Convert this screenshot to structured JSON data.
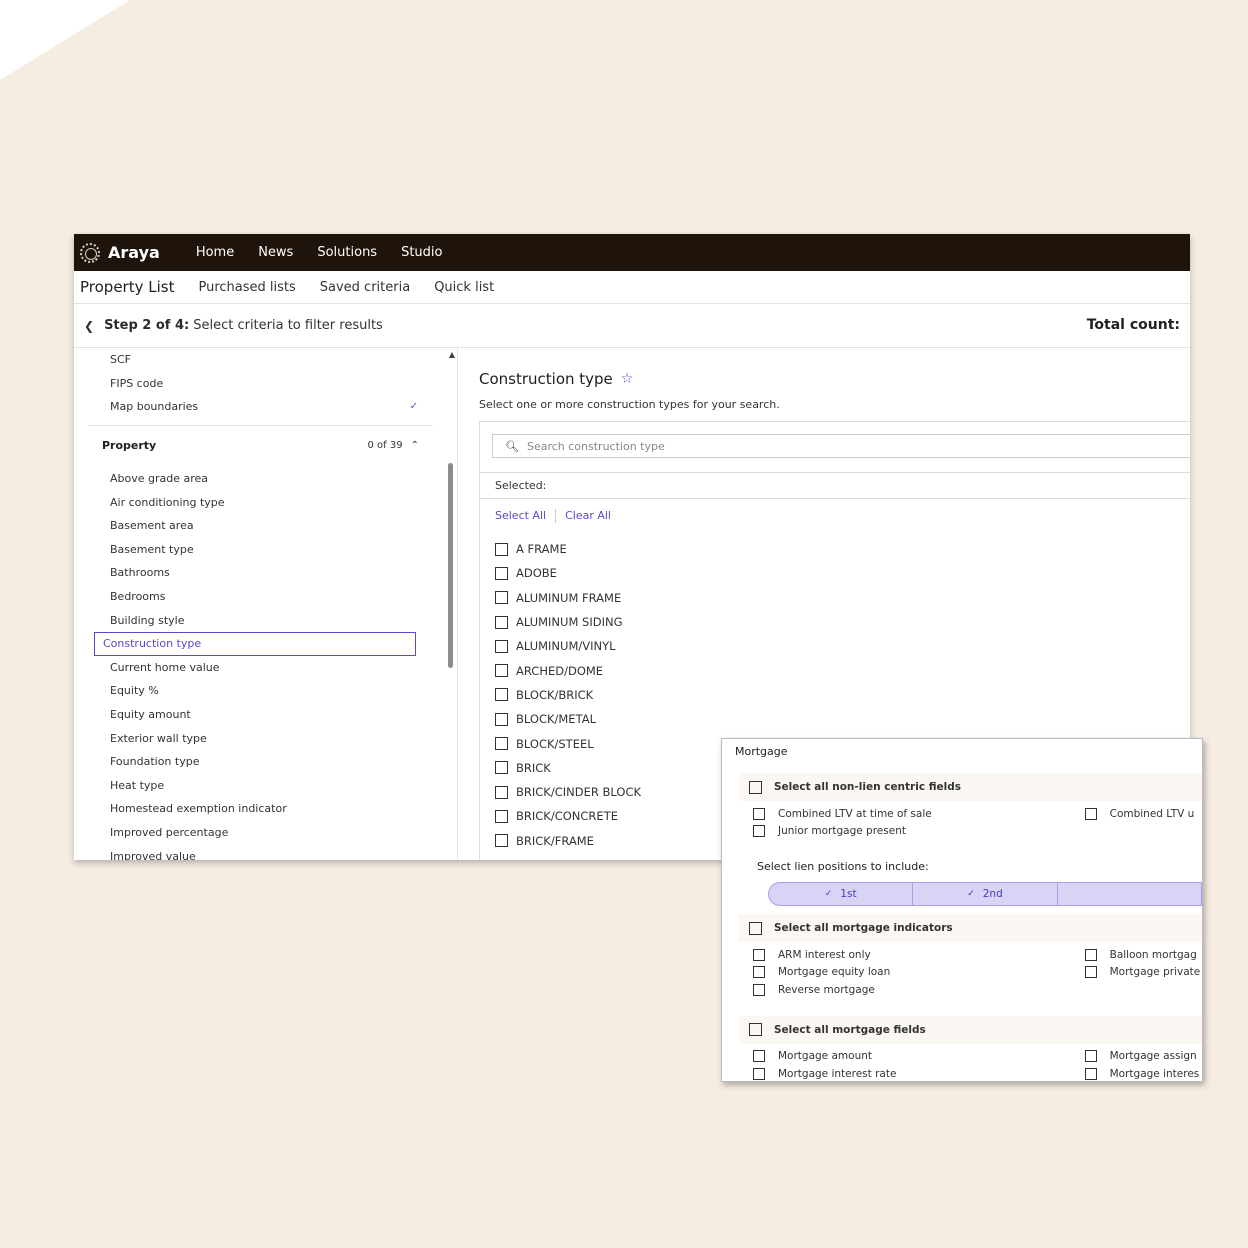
{
  "nav": {
    "brand": "Araya",
    "items": [
      "Home",
      "News",
      "Solutions",
      "Studio"
    ]
  },
  "subnav": {
    "title": "Property List",
    "items": [
      "Purchased lists",
      "Saved criteria",
      "Quick list"
    ]
  },
  "step": {
    "strong": "Step 2 of 4:",
    "text": "Select criteria to filter results",
    "total_label": "Total count:"
  },
  "sidebar": {
    "top_items": [
      "SCF",
      "FIPS code",
      "Map boundaries"
    ],
    "group": {
      "title": "Property",
      "count": "0 of 39"
    },
    "items": [
      "Above grade area",
      "Air conditioning type",
      "Basement area",
      "Basement type",
      "Bathrooms",
      "Bedrooms",
      "Building style",
      "Construction type",
      "Current home value",
      "Equity %",
      "Equity amount",
      "Exterior wall type",
      "Foundation type",
      "Heat type",
      "Homestead exemption indicator",
      "Improved percentage",
      "Improved value"
    ]
  },
  "main": {
    "title": "Construction type",
    "description": "Select one or more construction types for your search.",
    "search_placeholder": "Search construction type",
    "selected_label": "Selected:",
    "select_all": "Select All",
    "clear_all": "Clear All",
    "options": [
      "A FRAME",
      "ADOBE",
      "ALUMINUM FRAME",
      "ALUMINUM SIDING",
      "ALUMINUM/VINYL",
      "ARCHED/DOME",
      "BLOCK/BRICK",
      "BLOCK/METAL",
      "BLOCK/STEEL",
      "BRICK",
      "BRICK/CINDER BLOCK",
      "BRICK/CONCRETE",
      "BRICK/FRAME"
    ]
  },
  "overlay": {
    "title": "Mortgage",
    "sec1": {
      "head": "Select all non-lien centric fields",
      "col1": [
        "Combined LTV at time of sale",
        "Junior mortgage present"
      ],
      "col2": [
        "Combined LTV u"
      ]
    },
    "lien_label": "Select lien positions to include:",
    "lien_positions": [
      "1st",
      "2nd"
    ],
    "sec2": {
      "head": "Select all mortgage indicators",
      "col1": [
        "ARM interest only",
        "Mortgage equity loan",
        "Reverse mortgage"
      ],
      "col2": [
        "Balloon mortgag",
        "Mortgage private"
      ]
    },
    "sec3": {
      "head": "Select all mortgage fields",
      "col1": [
        "Mortgage amount",
        "Mortgage interest rate"
      ],
      "col2": [
        "Mortgage assign",
        "Mortgage interes"
      ]
    }
  },
  "colors": {
    "accent": "#5b49c9",
    "topbar": "#1e140c",
    "background": "#f6ede2"
  }
}
